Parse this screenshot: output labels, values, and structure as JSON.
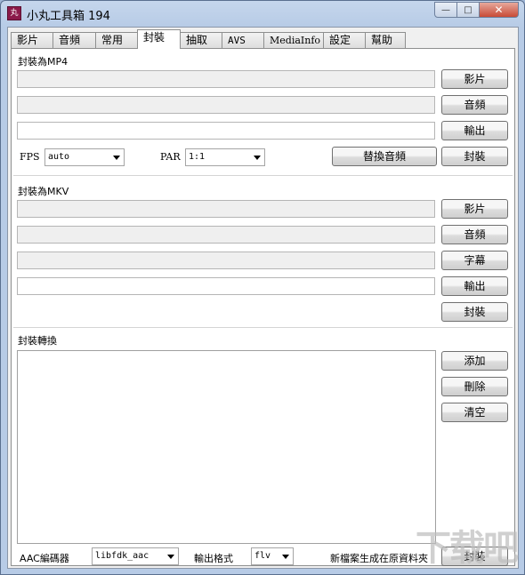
{
  "window": {
    "title": "小丸工具箱 194",
    "buttons": {
      "minimize": "—",
      "maximize": "□",
      "close": "✕"
    }
  },
  "tabs": [
    {
      "label": "影片",
      "active": false
    },
    {
      "label": "音頻",
      "active": false
    },
    {
      "label": "常用",
      "active": false
    },
    {
      "label": "封裝",
      "active": true
    },
    {
      "label": "抽取",
      "active": false
    },
    {
      "label": "AVS",
      "active": false
    },
    {
      "label": "MediaInfo",
      "active": false
    },
    {
      "label": "設定",
      "active": false
    },
    {
      "label": "幫助",
      "active": false
    }
  ],
  "mp4": {
    "title": "封裝為MP4",
    "video_btn": "影片",
    "audio_btn": "音頻",
    "output_btn": "輸出",
    "fps_label": "FPS",
    "fps_value": "auto",
    "par_label": "PAR",
    "par_value": "1:1",
    "replace_audio_btn": "替換音頻",
    "mux_btn": "封裝"
  },
  "mkv": {
    "title": "封裝為MKV",
    "video_btn": "影片",
    "audio_btn": "音頻",
    "subtitle_btn": "字幕",
    "output_btn": "輸出",
    "mux_btn": "封裝"
  },
  "convert": {
    "title": "封裝轉換",
    "add_btn": "添加",
    "delete_btn": "刪除",
    "clear_btn": "清空",
    "aac_label": "AAC編碼器",
    "aac_value": "libfdk_aac",
    "format_label": "輸出格式",
    "format_value": "flv",
    "note": "新檔案生成在原資料夾",
    "mux_btn": "封裝"
  },
  "watermark": "下载吧",
  "colors": {
    "close_button": "#c84a36",
    "panel_bg": "#ffffff",
    "window_frame": "#b7cbe6"
  }
}
